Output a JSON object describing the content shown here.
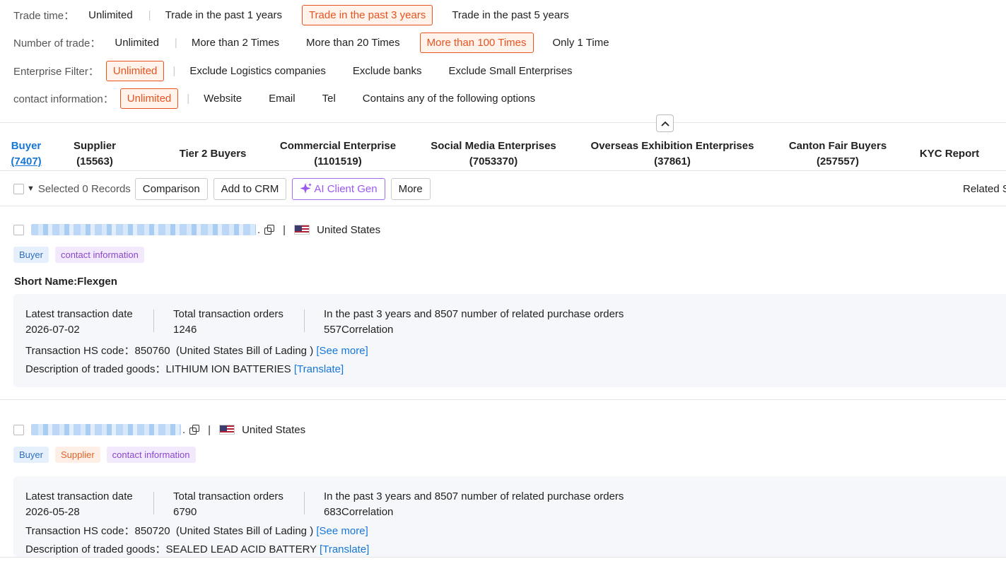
{
  "filters": {
    "trade_time": {
      "label": "Trade time：",
      "options": [
        "Unlimited",
        "Trade in the past 1 years",
        "Trade in the past 3 years",
        "Trade in the past 5 years"
      ],
      "selected": "Trade in the past 3 years"
    },
    "number_of_trade": {
      "label": "Number of trade：",
      "options": [
        "Unlimited",
        "More than 2 Times",
        "More than 20 Times",
        "More than 100 Times",
        "Only 1 Time"
      ],
      "selected": "More than 100 Times"
    },
    "enterprise_filter": {
      "label": "Enterprise Filter：",
      "options": [
        "Unlimited",
        "Exclude Logistics companies",
        "Exclude banks",
        "Exclude Small Enterprises"
      ],
      "selected": "Unlimited"
    },
    "contact_information": {
      "label": "contact information：",
      "options": [
        "Unlimited",
        "Website",
        "Email",
        "Tel",
        "Contains any of the following options"
      ],
      "selected": "Unlimited"
    }
  },
  "collapse_icon": "chevron-up-icon",
  "tabs": [
    {
      "label": "Buyer",
      "count": "(7407)",
      "active": true
    },
    {
      "label": "Supplier",
      "count": "(15563)"
    },
    {
      "label": "Tier 2 Buyers",
      "count": ""
    },
    {
      "label": "Commercial Enterprise",
      "count": "(1101519)"
    },
    {
      "label": "Social Media Enterprises",
      "count": "(7053370)"
    },
    {
      "label": "Overseas Exhibition Enterprises",
      "count": "(37861)"
    },
    {
      "label": "Canton Fair Buyers",
      "count": "(257557)"
    },
    {
      "label": "KYC Report",
      "count": ""
    }
  ],
  "toolbar": {
    "selected_text": "Selected 0 Records",
    "comparison": "Comparison",
    "add_to_crm": "Add to CRM",
    "ai_client_gen": "AI Client Gen",
    "more": "More",
    "related": "Related Shi"
  },
  "records": [
    {
      "country": "United States",
      "tags": [
        {
          "label": "Buyer",
          "kind": "buyer"
        },
        {
          "label": "contact information",
          "kind": "contact"
        }
      ],
      "short_name": "Short Name:Flexgen",
      "latest_date_label": "Latest transaction date",
      "latest_date": "2026-07-02",
      "total_orders_label": "Total transaction orders",
      "total_orders": "1246",
      "related_text": "In the past 3 years and 8507 number of related purchase orders",
      "correlation": "557Correlation",
      "hs_label": "Transaction HS code：",
      "hs_code": "850760",
      "hs_source": "(United States Bill of Lading )",
      "see_more": "[See more]",
      "goods_label": "Description of traded goods：",
      "goods": "LITHIUM ION BATTERIES",
      "translate": "[Translate]"
    },
    {
      "country": "United States",
      "tags": [
        {
          "label": "Buyer",
          "kind": "buyer"
        },
        {
          "label": "Supplier",
          "kind": "supplier"
        },
        {
          "label": "contact information",
          "kind": "contact"
        }
      ],
      "latest_date_label": "Latest transaction date",
      "latest_date": "2026-05-28",
      "total_orders_label": "Total transaction orders",
      "total_orders": "6790",
      "related_text": "In the past 3 years and 8507 number of related purchase orders",
      "correlation": "683Correlation",
      "hs_label": "Transaction HS code：",
      "hs_code": "850720",
      "hs_source": "(United States Bill of Lading )",
      "see_more": "[See more]",
      "goods_label": "Description of traded goods：",
      "goods": "SEALED LEAD ACID BATTERY",
      "translate": "[Translate]"
    }
  ]
}
